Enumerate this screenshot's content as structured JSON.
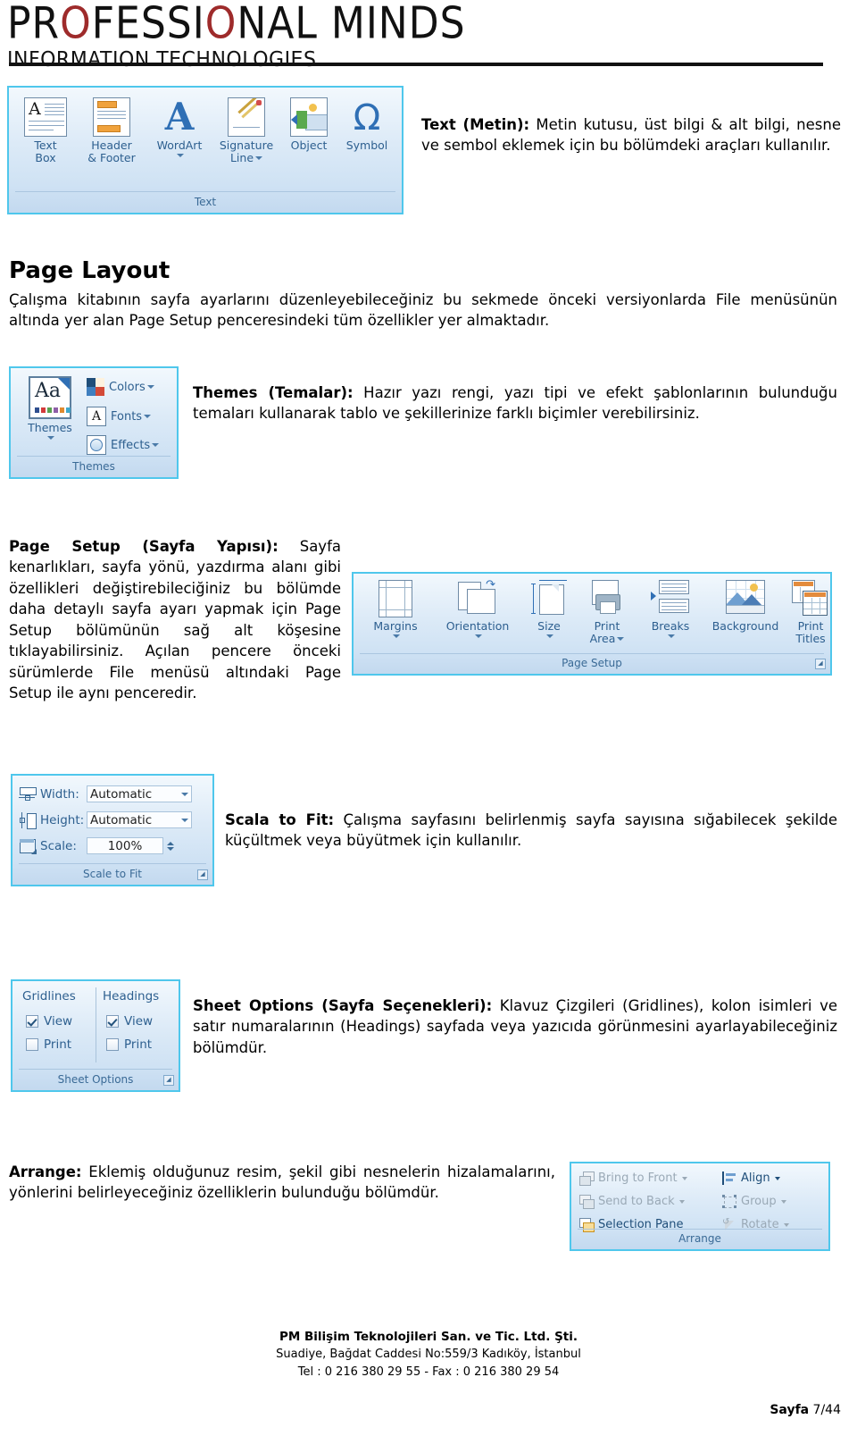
{
  "header": {
    "logo_line1_a": "PR",
    "logo_line1_o1": "O",
    "logo_line1_b": "FESSI",
    "logo_line1_o2": "O",
    "logo_line1_c": "NAL MINDS",
    "logo_line2": "INFORMATION TECHNOLOGIES"
  },
  "text_ribbon": {
    "group_label": "Text",
    "buttons": [
      {
        "label_line1": "Text",
        "label_line2": "Box",
        "icon": "text-box-icon",
        "has_caret": false
      },
      {
        "label_line1": "Header",
        "label_line2": "& Footer",
        "icon": "header-footer-icon",
        "has_caret": false
      },
      {
        "label_line1": "WordArt",
        "label_line2": "",
        "icon": "wordart-icon",
        "has_caret": true
      },
      {
        "label_line1": "Signature",
        "label_line2": "Line",
        "icon": "signature-line-icon",
        "has_caret": true
      },
      {
        "label_line1": "Object",
        "label_line2": "",
        "icon": "object-icon",
        "has_caret": false
      },
      {
        "label_line1": "Symbol",
        "label_line2": "",
        "icon": "symbol-omega-icon",
        "has_caret": false
      }
    ]
  },
  "text_desc": {
    "bold": "Text (Metin):",
    "rest": " Metin kutusu, üst bilgi & alt bilgi, nesne ve sembol eklemek için bu bölümdeki araçları kullanılır."
  },
  "page_layout": {
    "heading": "Page Layout",
    "paragraph": "Çalışma kitabının sayfa ayarlarını düzenleyebileceğiniz bu sekmede önceki versiyonlarda File menüsünün altında yer alan Page Setup penceresindeki tüm özellikler yer almaktadır."
  },
  "themes_ribbon": {
    "group_label": "Themes",
    "main_button": {
      "label": "Themes",
      "icon": "themes-Aa-icon",
      "has_caret": true
    },
    "items": [
      {
        "label": "Colors",
        "icon": "theme-colors-icon",
        "has_caret": true
      },
      {
        "label": "Fonts",
        "icon": "theme-fonts-icon",
        "has_caret": true
      },
      {
        "label": "Effects",
        "icon": "theme-effects-icon",
        "has_caret": true
      }
    ]
  },
  "themes_desc": {
    "bold": "Themes (Temalar):",
    "rest": " Hazır yazı rengi, yazı tipi ve efekt şablonlarının bulunduğu temaları kullanarak tablo ve şekillerinize farklı biçimler verebilirsiniz."
  },
  "page_setup_desc": {
    "bold": "Page Setup (Sayfa Yapısı):",
    "rest": " Sayfa kenarlıkları, sayfa yönü, yazdırma alanı gibi özellikleri değiştirebileciğiniz bu bölümde daha detaylı sayfa ayarı yapmak için Page Setup bölümünün sağ alt köşesine tıklayabilirsiniz. Açılan pencere önceki sürümlerde File menüsü altındaki Page Setup ile aynı penceredir."
  },
  "page_setup_ribbon": {
    "group_label": "Page Setup",
    "dialog_launcher": "launcher-icon",
    "buttons": [
      {
        "label_line1": "Margins",
        "label_line2": "",
        "icon": "margins-icon",
        "has_caret": true,
        "caret_inline": false
      },
      {
        "label_line1": "Orientation",
        "label_line2": "",
        "icon": "orientation-icon",
        "has_caret": true,
        "caret_inline": false
      },
      {
        "label_line1": "Size",
        "label_line2": "",
        "icon": "size-icon",
        "has_caret": true,
        "caret_inline": false
      },
      {
        "label_line1": "Print",
        "label_line2": "Area",
        "icon": "print-area-icon",
        "has_caret": true,
        "caret_inline": true
      },
      {
        "label_line1": "Breaks",
        "label_line2": "",
        "icon": "breaks-icon",
        "has_caret": true,
        "caret_inline": false
      },
      {
        "label_line1": "Background",
        "label_line2": "",
        "icon": "background-icon",
        "has_caret": false,
        "caret_inline": false
      },
      {
        "label_line1": "Print",
        "label_line2": "Titles",
        "icon": "print-titles-icon",
        "has_caret": false,
        "caret_inline": false
      }
    ]
  },
  "scale_to_fit": {
    "group_label": "Scale to Fit",
    "dialog_launcher": "launcher-icon",
    "rows": [
      {
        "label": "Width:",
        "value": "Automatic",
        "control": "dropdown",
        "icon": "fit-width-icon"
      },
      {
        "label": "Height:",
        "value": "Automatic",
        "control": "dropdown",
        "icon": "fit-height-icon"
      },
      {
        "label": "Scale:",
        "value": "100%",
        "control": "spinner",
        "icon": "scale-icon"
      }
    ]
  },
  "scale_desc": {
    "bold": "Scala to Fit:",
    "rest": " Çalışma sayfasını belirlenmiş sayfa sayısına sığabilecek şekilde küçültmek veya büyütmek için kullanılır."
  },
  "sheet_options": {
    "group_label": "Sheet Options",
    "dialog_launcher": "launcher-icon",
    "columns": [
      {
        "header": "Gridlines",
        "checks": [
          {
            "label": "View",
            "checked": true
          },
          {
            "label": "Print",
            "checked": false
          }
        ]
      },
      {
        "header": "Headings",
        "checks": [
          {
            "label": "View",
            "checked": true
          },
          {
            "label": "Print",
            "checked": false
          }
        ]
      }
    ]
  },
  "sheet_options_desc": {
    "bold": "Sheet Options (Sayfa Seçenekleri):",
    "rest": " Klavuz Çizgileri (Gridlines), kolon isimleri ve satır numaralarının (Headings) sayfada veya yazıcıda görünmesini ayarlayabileceğiniz bölümdür."
  },
  "arrange_desc": {
    "bold": "Arrange:",
    "rest": " Eklemiş olduğunuz resim, şekil gibi nesnelerin hizalamalarını, yönlerini belirleyeceğiniz özelliklerin bulunduğu bölümdür."
  },
  "arrange_ribbon": {
    "group_label": "Arrange",
    "items": [
      {
        "label": "Bring to Front",
        "icon": "bring-to-front-icon",
        "has_caret": true,
        "enabled": false
      },
      {
        "label": "Align",
        "icon": "align-icon",
        "has_caret": true,
        "enabled": true
      },
      {
        "label": "Send to Back",
        "icon": "send-to-back-icon",
        "has_caret": true,
        "enabled": false
      },
      {
        "label": "Group",
        "icon": "group-icon",
        "has_caret": true,
        "enabled": false
      },
      {
        "label": "Selection Pane",
        "icon": "selection-pane-icon",
        "has_caret": false,
        "enabled": true
      },
      {
        "label": "Rotate",
        "icon": "rotate-icon",
        "has_caret": true,
        "enabled": false
      }
    ]
  },
  "footer": {
    "line1": "PM Bilişim Teknolojileri San. ve Tic. Ltd. Şti.",
    "line2": "Suadiye, Bağdat Caddesi No:559/3 Kadıköy, İstanbul",
    "line3": "Tel : 0 216 380 29 55  -  Fax : 0 216 380 29 54",
    "page_label": "Sayfa",
    "page_value": " 7/44"
  },
  "colors": {
    "ribbon_border": "#4fc7ec",
    "ribbon_text": "#2d5f8f",
    "logo_accent": "#9e2b2b",
    "rule": "#111111"
  }
}
